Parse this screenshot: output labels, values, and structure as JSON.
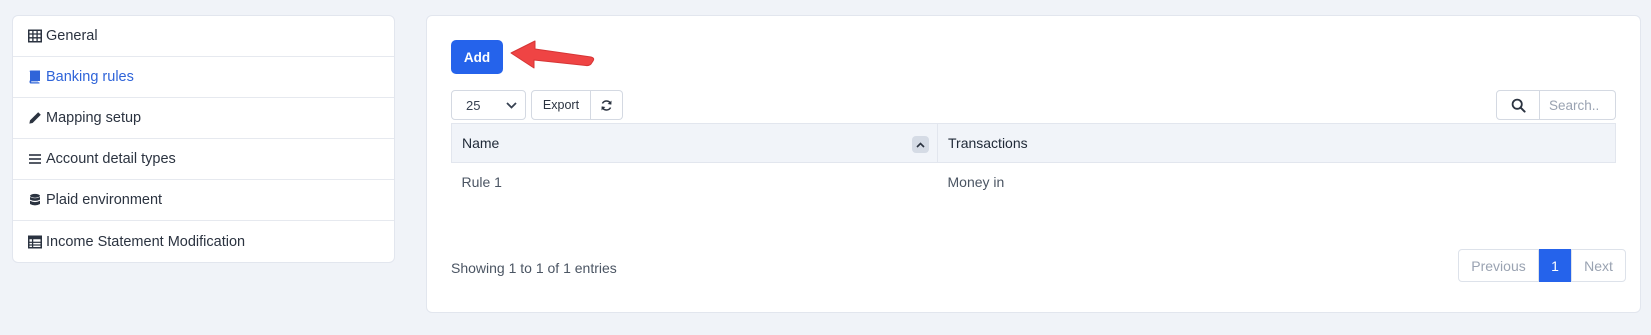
{
  "sidebar": {
    "items": [
      {
        "label": "General",
        "icon": "table-grid-icon",
        "active": false
      },
      {
        "label": "Banking rules",
        "icon": "book-icon",
        "active": true
      },
      {
        "label": "Mapping setup",
        "icon": "pencil-icon",
        "active": false
      },
      {
        "label": "Account detail types",
        "icon": "list-icon",
        "active": false
      },
      {
        "label": "Plaid environment",
        "icon": "database-icon",
        "active": false
      },
      {
        "label": "Income Statement Modification",
        "icon": "table-list-icon",
        "active": false
      }
    ]
  },
  "toolbar": {
    "add_label": "Add",
    "page_length": "25",
    "export_label": "Export",
    "search_placeholder": "Search.."
  },
  "table": {
    "columns": [
      "Name",
      "Transactions"
    ],
    "rows": [
      [
        "Rule 1",
        "Money in"
      ]
    ]
  },
  "footer": {
    "info": "Showing 1 to 1 of 1 entries",
    "previous": "Previous",
    "page": "1",
    "next": "Next"
  },
  "colors": {
    "accent": "#2563eb",
    "active_link": "#2f64d9",
    "arrow": "#ef4444",
    "background": "#f0f3f8"
  }
}
